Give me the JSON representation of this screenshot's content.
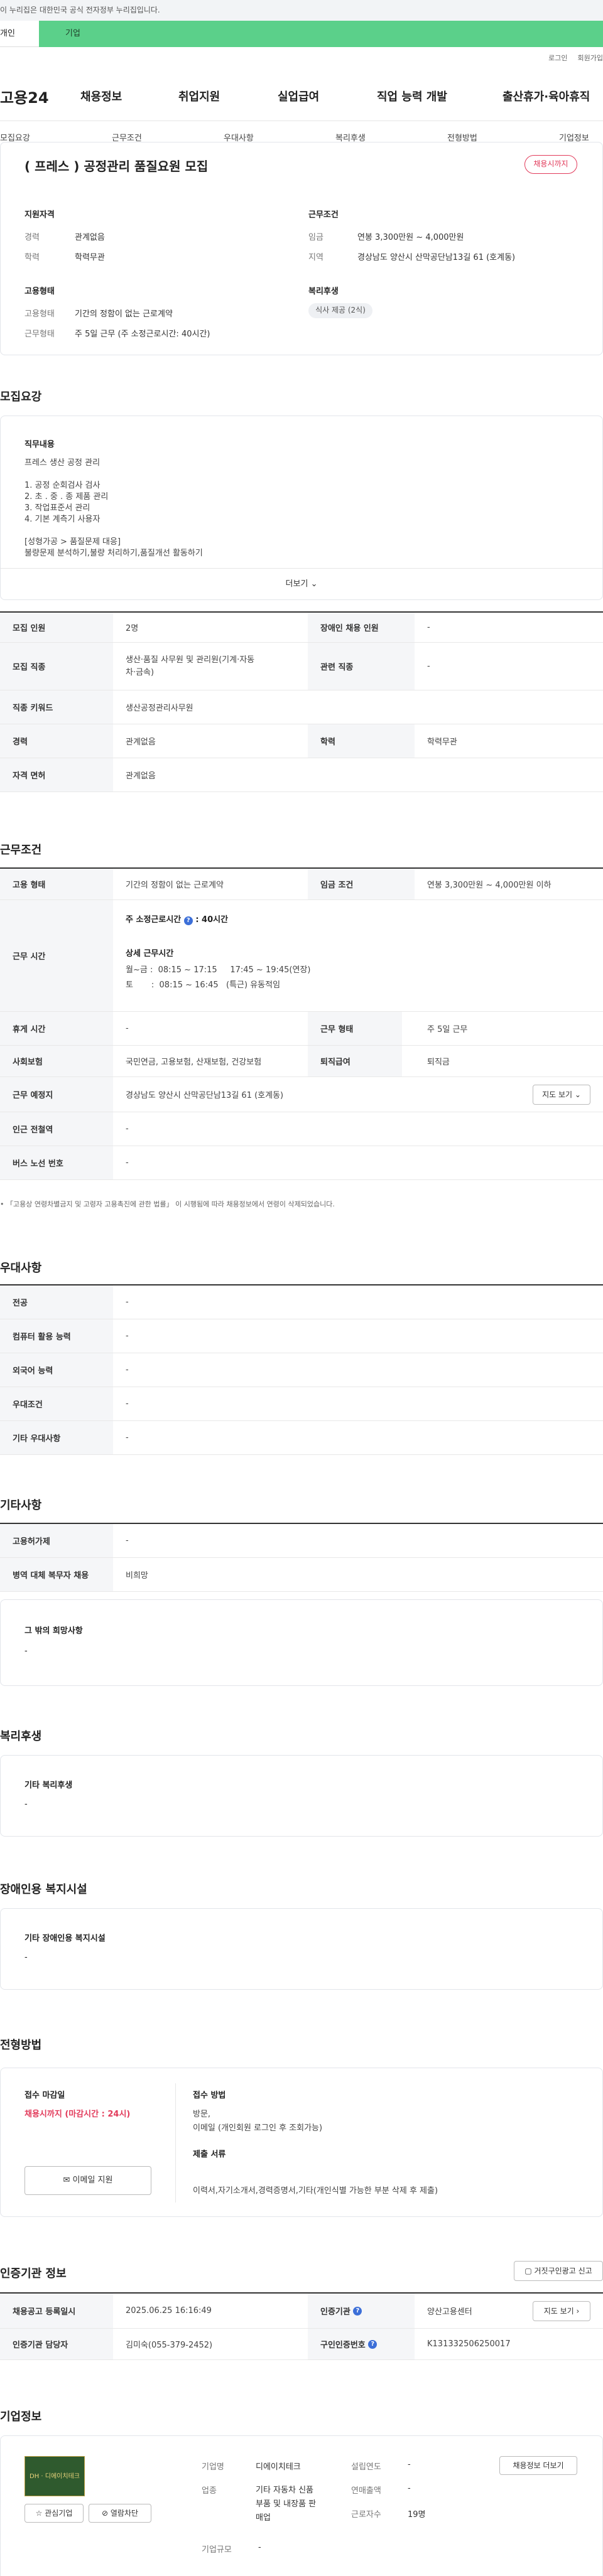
{
  "gov_bar": {
    "text": "이 누리집은 대한민국 공식 전자정부 누리집입니다."
  },
  "tabs": {
    "personal": "개인",
    "company": "기업"
  },
  "util": {
    "login": "로그인",
    "join": "회원가입"
  },
  "logo": "고용24",
  "gnb": [
    "채용정보",
    "취업지원",
    "실업급여",
    "직업 능력 개발",
    "출산휴가·육아휴직"
  ],
  "subnav": [
    "모집요강",
    "근무조건",
    "우대사항",
    "복리후생",
    "전형방법",
    "기업정보"
  ],
  "summary": {
    "title": "( 프레스 ) 공정관리 품질요원 모집",
    "badge": "채용시까지",
    "qual_head": "지원자격",
    "exp_lbl": "경력",
    "exp_val": "관계없음",
    "edu_lbl": "학력",
    "edu_val": "학력무관",
    "cond_head": "근무조건",
    "wage_lbl": "임금",
    "wage_val": "연봉 3,300만원 ~ 4,000만원",
    "loc_lbl": "지역",
    "loc_val": "경상남도 양산시 산막공단남13길 61 (호계동)",
    "emp_head": "고용형태",
    "type_lbl": "고용형태",
    "type_val": "기간의 정함이 없는 근로계약",
    "form_lbl": "근무형태",
    "form_val": "주 5일 근무 (주 소정근로시간: 40시간)",
    "welfare_head": "복리후생",
    "welfare_pill": "식사 제공 (2식)"
  },
  "recruit": {
    "heading": "모집요강",
    "job_lbl": "직무내용",
    "lines": [
      "프레스 생산 공정 관리",
      "",
      "1.  공정 순회검사 검사",
      "2.  초 . 중 . 종 제품 관리",
      "3.  작업표준서 관리",
      "4.  기본 계측기 사용자",
      "",
      "[성형가공 > 품질문제 대응]",
      "불량문제 분석하기,불량 처리하기,품질개선 활동하기"
    ],
    "more": "더보기",
    "table": {
      "count_lbl": "모집 인원",
      "count_val": "2명",
      "dis_lbl": "장애인 채용 인원",
      "dis_val": "-",
      "job_lbl": "모집 직종",
      "job_val": "생산·품질 사무원 및 관리원(기계·자동차·금속)",
      "rel_lbl": "관련 직종",
      "rel_val": "-",
      "kw_lbl": "직종 키워드",
      "kw_val": "생산공정관리사무원",
      "exp_lbl": "경력",
      "exp_val": "관계없음",
      "edu_lbl": "학력",
      "edu_val": "학력무관",
      "lic_lbl": "자격 면허",
      "lic_val": "관계없음"
    }
  },
  "work": {
    "heading": "근무조건",
    "type_lbl": "고용 형태",
    "type_val": "기간의 정함이 없는 근로계약",
    "wage_lbl": "임금 조건",
    "wage_val": "연봉 3,300만원 ~ 4,000만원 이하",
    "hours_lbl": "근무 시간",
    "weekly": "주 소정근로시간",
    "weekly_val": ": 40시간",
    "detail": "상세 근무시간",
    "wd": "월~금 :  08:15 ~ 17:15     17:45 ~ 19:45(연장)",
    "sat": "토       :  08:15 ~ 16:45   (특근) 유동적임",
    "rest_lbl": "휴게 시간",
    "rest_val": "-",
    "shift_lbl": "근무 형태",
    "shift_val": "주 5일 근무",
    "ins_lbl": "사회보험",
    "ins_val": "국민연금, 고용보험, 산재보험, 건강보험",
    "ret_lbl": "퇴직급여",
    "ret_val": "퇴직금",
    "place_lbl": "근무 예정지",
    "place_val": "경상남도 양산시 산막공단남13길 61 (호계동)",
    "map_btn": "지도 보기",
    "sub_lbl": "인근 전철역",
    "sub_val": "-",
    "bus_lbl": "버스 노선 번호",
    "bus_val": "-",
    "note": "「고용상 연령차별금지 및 고령자 고용촉진에 관한 법률」 이 시행됨에 따라 채용정보에서 연령이 삭제되었습니다."
  },
  "pref": {
    "heading": "우대사항",
    "rows": [
      {
        "k": "전공",
        "v": "-"
      },
      {
        "k": "컴퓨터 활용 능력",
        "v": "-"
      },
      {
        "k": "외국어 능력",
        "v": "-"
      },
      {
        "k": "우대조건",
        "v": "-"
      },
      {
        "k": "기타 우대사항",
        "v": "-"
      }
    ]
  },
  "etc": {
    "heading": "기타사항",
    "rows": [
      {
        "k": "고용허가제",
        "v": "-"
      },
      {
        "k": "병역 대체 복무자 채용",
        "v": "비희망"
      }
    ],
    "box_lbl": "그 밖의 희망사항",
    "box_val": "-"
  },
  "welfare": {
    "heading": "복리후생",
    "box_lbl": "기타 복리후생",
    "box_val": "-"
  },
  "disab": {
    "heading": "장애인용 복지시설",
    "box_lbl": "기타 장애인용 복지시설",
    "box_val": "-"
  },
  "select": {
    "heading": "전형방법",
    "deadline_lbl": "접수 마감일",
    "deadline_val": "채용시까지 (마감시간 : 24시)",
    "apply_btn": "이메일 지원",
    "method_lbl": "접수 방법",
    "method_val1": "방문,",
    "method_val2": "이메일 (개인회원 로그인 후 조회가능)",
    "docs_lbl": "제출 서류",
    "docs_val": "이력서,자기소개서,경력증명서,기타(개인식별 가능한 부분 삭제 후 제출)"
  },
  "cert": {
    "heading": "인증기관 정보",
    "report_btn": "거짓구인광고 신고",
    "date_lbl": "채용공고 등록일시",
    "date_val": "2025.06.25 16:16:49",
    "org_lbl": "인증기관",
    "org_val": "양산고용센터",
    "map_btn": "지도 보기",
    "mgr_lbl": "인증기관 담당자",
    "mgr_val": "김미숙(055-379-2452)",
    "no_lbl": "구인인증번호",
    "no_val": "K131332506250017"
  },
  "company": {
    "heading": "기업정보",
    "fav_btn": "관심기업",
    "block_btn": "열람차단",
    "list_btn": "채용정보 더보기",
    "name_lbl": "기업명",
    "name_val": "디에이치테크",
    "year_lbl": "설립연도",
    "year_val": "-",
    "ind_lbl": "업종",
    "ind_val1": "기타 자동차 신품",
    "ind_val2": "부품 및 내장품 판",
    "ind_val3": "매업",
    "sales_lbl": "연매출액",
    "sales_val": "-",
    "emp_lbl": "근로자수",
    "emp_val": "19명",
    "size_lbl": "기업규모",
    "size_val": "-",
    "logo_text": "디에이치테크"
  }
}
